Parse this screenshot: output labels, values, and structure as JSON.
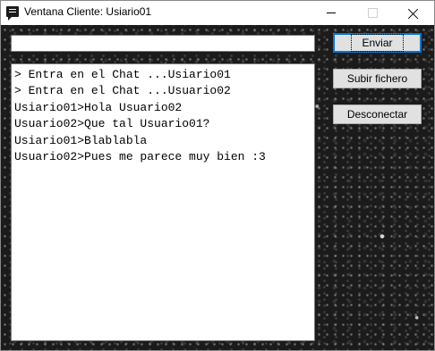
{
  "window": {
    "title": "Ventana Cliente: Usiario01",
    "app_icon": "chat-bubble-icon",
    "controls": {
      "minimize_icon": "minimize-icon",
      "maximize_icon": "maximize-icon",
      "close_icon": "close-icon"
    }
  },
  "input": {
    "value": "",
    "placeholder": ""
  },
  "chat": {
    "lines": [
      "> Entra en el Chat ...Usiario01",
      "> Entra en el Chat ...Usuario02",
      "Usiario01>Hola Usuario02",
      "Usuario02>Que tal Usuario01?",
      "Usiario01>Blablabla",
      "Usuario02>Pues me parece muy bien :3"
    ]
  },
  "buttons": {
    "send_label": "Enviar",
    "upload_label": "Subir fichero",
    "disconnect_label": "Desconectar"
  },
  "colors": {
    "background_texture": "#1b1b1b",
    "button_face": "#e1e1e1",
    "default_button_border": "#0078d7"
  }
}
